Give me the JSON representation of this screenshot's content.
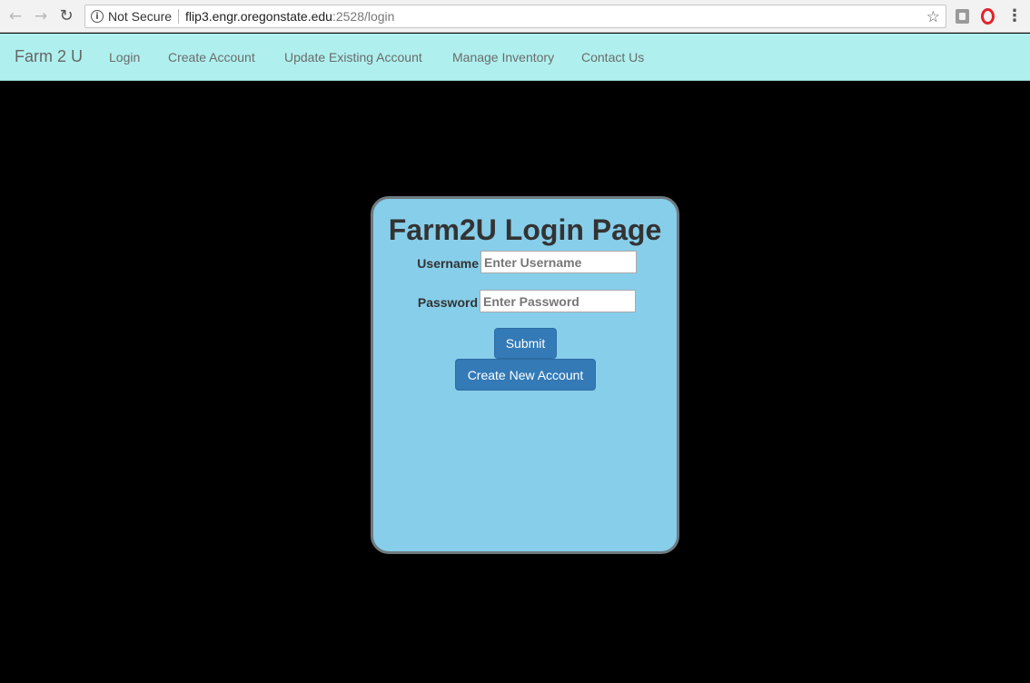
{
  "browser": {
    "security_label": "Not Secure",
    "url_host": "flip3.engr.oregonstate.edu",
    "url_path": ":2528/login"
  },
  "navbar": {
    "brand": "Farm 2 U",
    "links": [
      {
        "label": "Login"
      },
      {
        "label": "Create Account"
      },
      {
        "label": "Update Existing Account"
      },
      {
        "label": "Manage Inventory"
      },
      {
        "label": "Contact Us"
      }
    ]
  },
  "login": {
    "title": "Farm2U Login Page",
    "username_label": "Username",
    "username_placeholder": "Enter Username",
    "password_label": "Password",
    "password_placeholder": "Enter Password",
    "submit_label": "Submit",
    "create_account_label": "Create New Account"
  },
  "colors": {
    "navbar_bg": "#aff0ee",
    "card_bg": "#87ceea",
    "button_bg": "#337ab7",
    "page_bg": "#000000"
  }
}
